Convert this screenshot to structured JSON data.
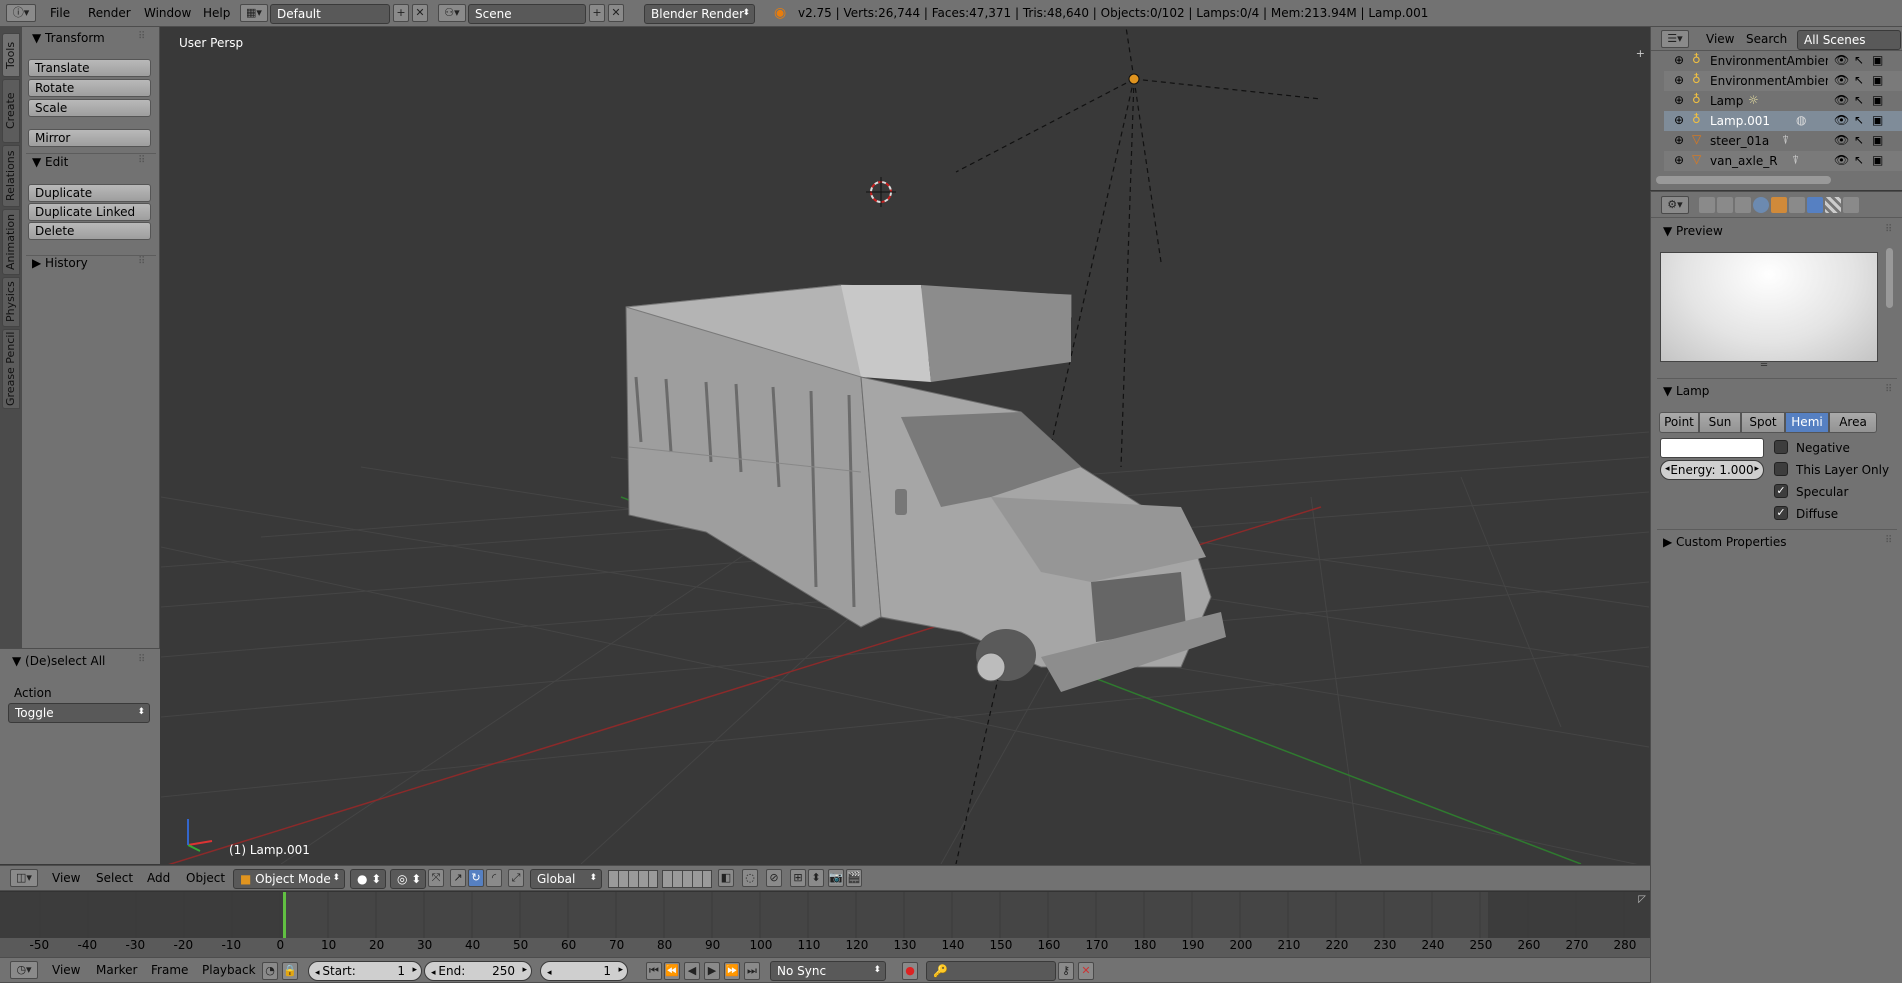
{
  "topbar": {
    "menus": [
      "File",
      "Render",
      "Window",
      "Help"
    ],
    "layout_name": "Default",
    "scene_name": "Scene",
    "render_engine": "Blender Render",
    "stats": "v2.75 | Verts:26,744 | Faces:47,371 | Tris:48,640 | Objects:0/102 | Lamps:0/4 | Mem:213.94M | Lamp.001"
  },
  "tool_tabs": [
    "Tools",
    "Create",
    "Relations",
    "Animation",
    "Physics",
    "Grease Pencil"
  ],
  "toolshelf": {
    "transform_title": "Transform",
    "transform_buttons": [
      "Translate",
      "Rotate",
      "Scale"
    ],
    "mirror": "Mirror",
    "edit_title": "Edit",
    "edit_buttons": [
      "Duplicate",
      "Duplicate Linked",
      "Delete"
    ],
    "history_title": "History",
    "operator_title": "(De)select All",
    "action_label": "Action",
    "action_value": "Toggle"
  },
  "viewport": {
    "view_name": "User Persp",
    "active_object": "(1) Lamp.001"
  },
  "outliner": {
    "menus": [
      "View",
      "Search"
    ],
    "scope": "All Scenes",
    "rows": [
      "EnvironmentAmbientLi",
      "EnvironmentAmbientLi",
      "Lamp",
      "Lamp.001",
      "steer_01a",
      "van_axle_R"
    ]
  },
  "properties": {
    "preview_title": "Preview",
    "lamp_title": "Lamp",
    "lamp_types": [
      "Point",
      "Sun",
      "Spot",
      "Hemi",
      "Area"
    ],
    "active_lamp_type": "Hemi",
    "energy_label": "Energy:",
    "energy_value": "1.000",
    "options": [
      {
        "label": "Negative",
        "checked": false
      },
      {
        "label": "This Layer Only",
        "checked": false
      },
      {
        "label": "Specular",
        "checked": true
      },
      {
        "label": "Diffuse",
        "checked": true
      }
    ],
    "custom_props_title": "Custom Properties"
  },
  "view3d_header": {
    "menus": [
      "View",
      "Select",
      "Add",
      "Object"
    ],
    "mode": "Object Mode",
    "orientation": "Global"
  },
  "timeline": {
    "ticks": [
      "-50",
      "-40",
      "-30",
      "-20",
      "-10",
      "0",
      "10",
      "20",
      "30",
      "40",
      "50",
      "60",
      "70",
      "80",
      "90",
      "100",
      "110",
      "120",
      "130",
      "140",
      "150",
      "160",
      "170",
      "180",
      "190",
      "200",
      "210",
      "220",
      "230",
      "240",
      "250",
      "260",
      "270",
      "280"
    ],
    "current_frame_marker": "0"
  },
  "timeline_header": {
    "menus": [
      "View",
      "Marker",
      "Frame",
      "Playback"
    ],
    "start_label": "Start:",
    "start_value": "1",
    "end_label": "End:",
    "end_value": "250",
    "current_frame": "1",
    "sync": "No Sync"
  },
  "colors": {
    "accent_blue": "#5680c2",
    "active_frame": "#61c042",
    "x_axis": "#8b2a2a",
    "y_axis": "#2f7a2f"
  }
}
